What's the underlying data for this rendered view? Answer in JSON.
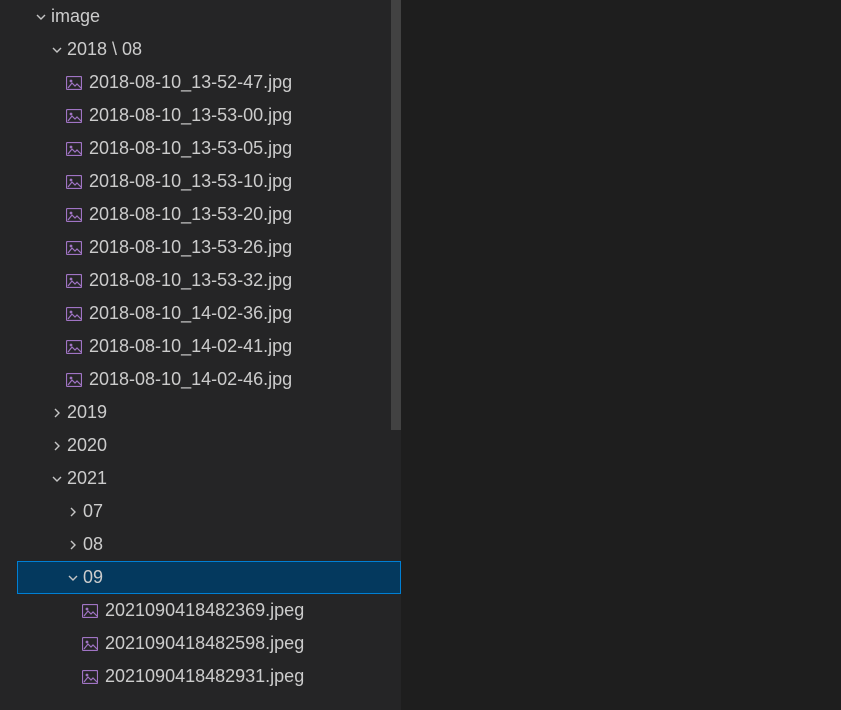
{
  "tree": {
    "root": {
      "label": "image",
      "expanded": true,
      "children": [
        {
          "label": "2018 \\ 08",
          "expanded": true,
          "files": [
            "2018-08-10_13-52-47.jpg",
            "2018-08-10_13-53-00.jpg",
            "2018-08-10_13-53-05.jpg",
            "2018-08-10_13-53-10.jpg",
            "2018-08-10_13-53-20.jpg",
            "2018-08-10_13-53-26.jpg",
            "2018-08-10_13-53-32.jpg",
            "2018-08-10_14-02-36.jpg",
            "2018-08-10_14-02-41.jpg",
            "2018-08-10_14-02-46.jpg"
          ]
        },
        {
          "label": "2019",
          "expanded": false
        },
        {
          "label": "2020",
          "expanded": false
        },
        {
          "label": "2021",
          "expanded": true,
          "children": [
            {
              "label": "07",
              "expanded": false
            },
            {
              "label": "08",
              "expanded": false
            },
            {
              "label": "09",
              "expanded": true,
              "selected": true,
              "files": [
                "2021090418482369.jpeg",
                "2021090418482598.jpeg",
                "2021090418482931.jpeg"
              ]
            }
          ]
        }
      ]
    }
  },
  "icons": {
    "image_file_color": "#a074c4"
  }
}
